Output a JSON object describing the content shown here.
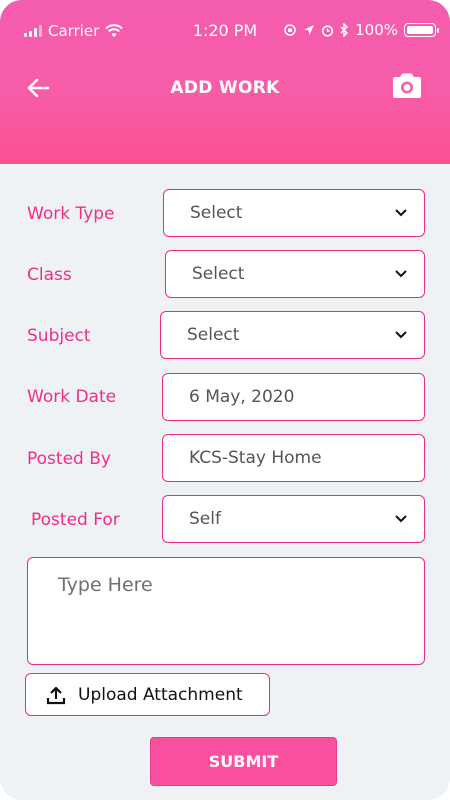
{
  "status_bar": {
    "carrier": "Carrier",
    "time": "1:20 PM",
    "battery": "100%"
  },
  "header": {
    "title": "ADD WORK",
    "back_icon": "arrow-left-icon",
    "camera_icon": "camera-icon",
    "gradient_top": "#f45cae",
    "gradient_bottom": "#fb4f93"
  },
  "form": {
    "work_type": {
      "label": "Work Type",
      "value": "Select"
    },
    "class": {
      "label": "Class",
      "value": "Select"
    },
    "subject": {
      "label": "Subject",
      "value": "Select"
    },
    "work_date": {
      "label": "Work Date",
      "value": "6 May, 2020"
    },
    "posted_by": {
      "label": "Posted By",
      "value": "KCS-Stay Home"
    },
    "posted_for": {
      "label": "Posted For",
      "value": "Self"
    },
    "description": {
      "placeholder": "Type Here"
    },
    "upload_label": "Upload Attachment",
    "submit_label": "SUBMIT"
  },
  "colors": {
    "accent": "#ee2f8a",
    "background": "#eef2f5"
  }
}
